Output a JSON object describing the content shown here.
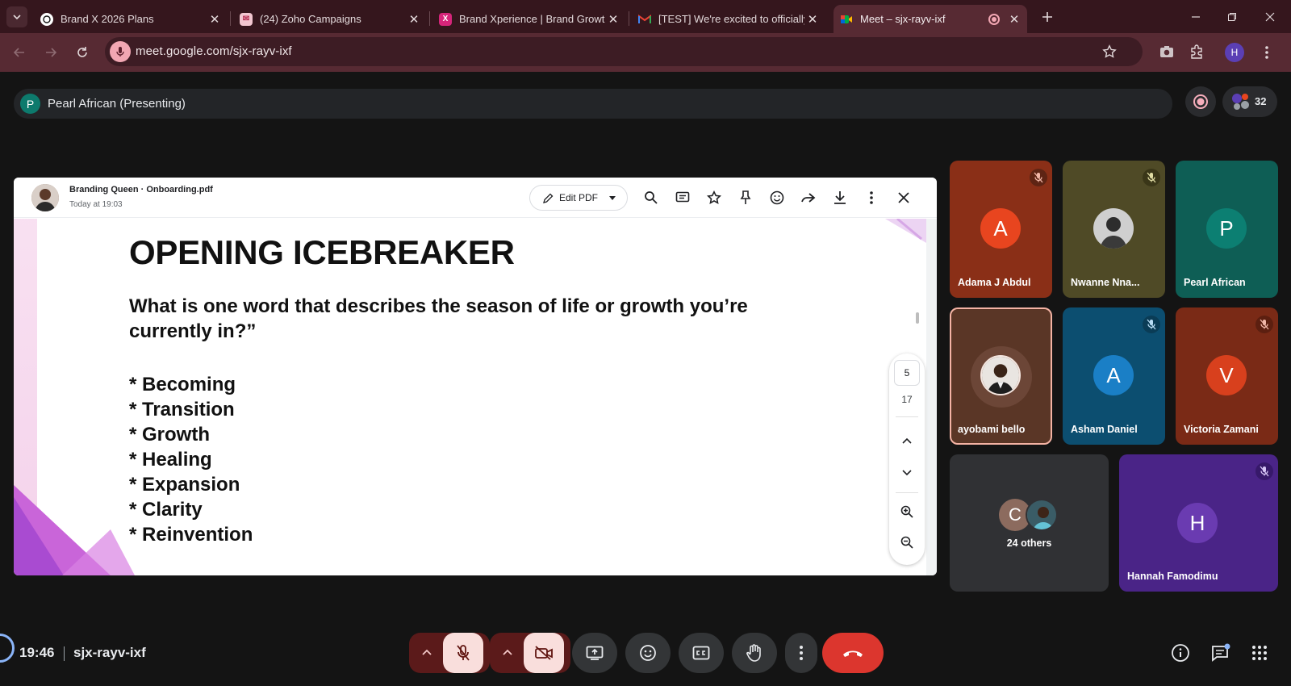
{
  "browser": {
    "tabs": [
      {
        "title": "Brand X 2026 Plans",
        "icon": "chatgpt-icon"
      },
      {
        "title": "(24) Zoho Campaigns",
        "icon": "zoho-campaigns-icon"
      },
      {
        "title": "Brand Xperience | Brand Growth",
        "icon": "brand-xperience-icon"
      },
      {
        "title": "[TEST] We're excited to officially",
        "icon": "gmail-icon"
      },
      {
        "title": "Meet – sjx-rayv-ixf",
        "icon": "google-meet-icon",
        "active": true
      }
    ],
    "url": "meet.google.com/sjx-rayv-ixf",
    "profile_initial": "H"
  },
  "meet": {
    "presenter_initial": "P",
    "presenter_label": "Pearl African (Presenting)",
    "participant_count": "32",
    "pdf": {
      "owner": "Branding Queen",
      "filename": "Onboarding.pdf",
      "file_label": "Branding Queen · Onboarding.pdf",
      "date": "Today at 19:03",
      "edit_label": "Edit PDF",
      "slide": {
        "title": "OPENING ICEBREAKER",
        "question": "What is one word that describes the season of life or growth you’re currently in?”",
        "bullets": [
          "* Becoming",
          "* Transition",
          "* Growth",
          "* Healing",
          "* Expansion",
          "* Clarity",
          "* Reinvention"
        ]
      },
      "current_page": "5",
      "total_pages": "17"
    },
    "participants": [
      {
        "name": "Adama J Abdul",
        "initial": "A",
        "bg": "#8a2f17",
        "avatar_color": "#e8451f",
        "muted": true
      },
      {
        "name": "Nwanne Nna...",
        "initial": "",
        "bg": "#4f4a26",
        "avatar_color": "#d9d9d9",
        "muted": true
      },
      {
        "name": "Pearl African",
        "initial": "P",
        "bg": "#0e5e55",
        "avatar_color": "#0c7f72",
        "muted": false
      },
      {
        "name": "ayobami bello",
        "initial": "",
        "bg": "#5a3626",
        "avatar_color": "#7a5545",
        "muted": false,
        "speaking": true
      },
      {
        "name": "Asham Daniel",
        "initial": "A",
        "bg": "#0c4e70",
        "avatar_color": "#1a7fc6",
        "muted": true
      },
      {
        "name": "Victoria Zamani",
        "initial": "V",
        "bg": "#7a2a16",
        "avatar_color": "#d8401d",
        "muted": true
      },
      {
        "name": "24 others",
        "initial": "C",
        "bg": "#303134",
        "avatar_color": "#8c6b5e",
        "muted": false
      },
      {
        "name": "Hannah Famodimu",
        "initial": "H",
        "bg": "#4a2487",
        "avatar_color": "#6a3bb1",
        "muted": true
      }
    ],
    "bottom": {
      "time": "19:46",
      "meeting_code": "sjx-rayv-ixf"
    }
  }
}
